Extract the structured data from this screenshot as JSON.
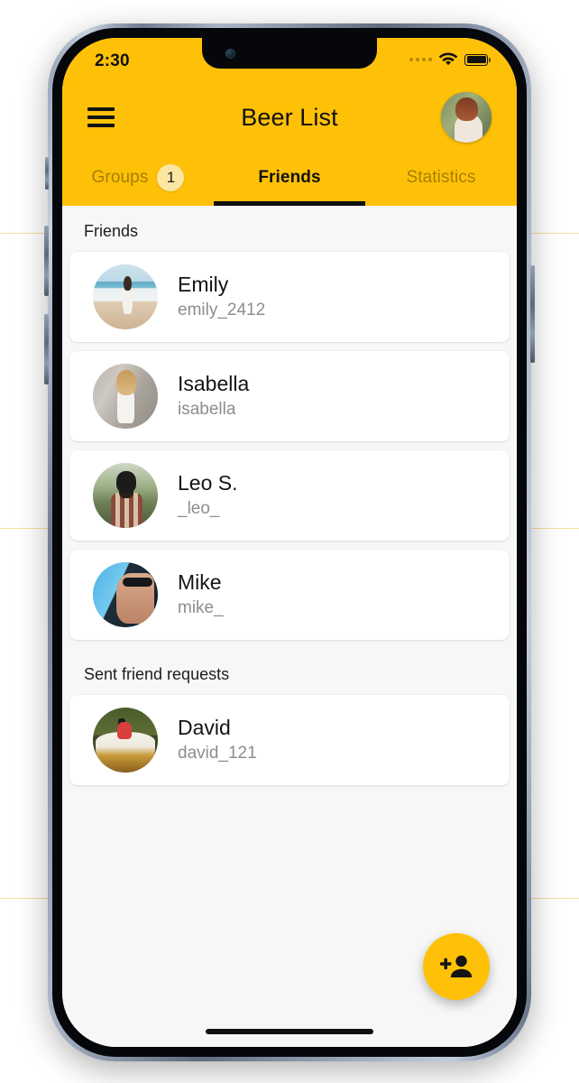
{
  "colors": {
    "accent": "#FFC107",
    "badge_bg": "#FBE6A2",
    "screen_bg": "#F7F7F7",
    "card_bg": "#FFFFFF",
    "primary_text": "#141414",
    "secondary_text": "#8D8D8D",
    "indicator": "#111111"
  },
  "status_bar": {
    "time": "2:30",
    "cellular_icon": "signal-dots-icon",
    "wifi_icon": "wifi-icon",
    "battery_icon": "battery-full-icon"
  },
  "app_bar": {
    "menu_icon": "hamburger-menu-icon",
    "title": "Beer List",
    "avatar_icon": "user-avatar"
  },
  "tabs": [
    {
      "label": "Groups",
      "badge": "1",
      "active": false,
      "name": "tab-groups"
    },
    {
      "label": "Friends",
      "badge": "",
      "active": true,
      "name": "tab-friends"
    },
    {
      "label": "Statistics",
      "badge": "",
      "active": false,
      "name": "tab-statistics"
    }
  ],
  "sections": [
    {
      "header": "Friends",
      "items": [
        {
          "name": "Emily",
          "username": "emily_2412",
          "art": "art-emily"
        },
        {
          "name": "Isabella",
          "username": "isabella",
          "art": "art-isabella"
        },
        {
          "name": "Leo S.",
          "username": "_leo_",
          "art": "art-leo"
        },
        {
          "name": "Mike",
          "username": "mike_",
          "art": "art-mike"
        }
      ]
    },
    {
      "header": "Sent friend requests",
      "items": [
        {
          "name": "David",
          "username": "david_121",
          "art": "art-david"
        }
      ]
    }
  ],
  "fab": {
    "icon": "person-add-icon",
    "label": "Add friend"
  },
  "home_indicator": "home-indicator"
}
